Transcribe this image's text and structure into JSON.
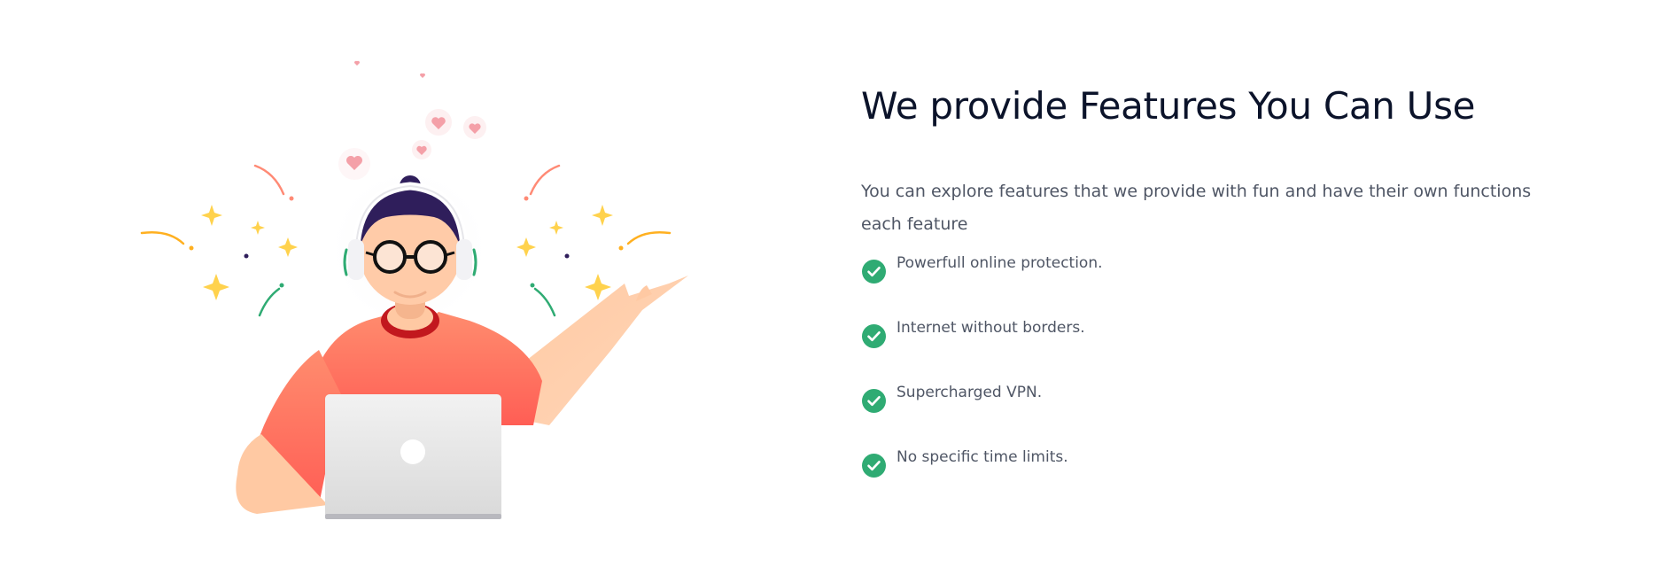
{
  "section": {
    "heading": "We provide Features You Can Use",
    "description": "You can explore features that we provide with fun and have their own functions each feature",
    "features": [
      {
        "label": "Powerfull online protection.",
        "icon": "check-circle-icon"
      },
      {
        "label": "Internet without borders.",
        "icon": "check-circle-icon"
      },
      {
        "label": "Supercharged VPN.",
        "icon": "check-circle-icon"
      },
      {
        "label": "No specific time limits.",
        "icon": "check-circle-icon"
      }
    ]
  },
  "illustration": {
    "subject": "person-with-headphones-and-laptop",
    "accent_check_color": "#2FAB73",
    "shirt_color": "#FF7260",
    "hair_color": "#2F1E5B",
    "skin_color": "#FFCBA8",
    "sparkle_color": "#FFD24D",
    "heart_color": "#F4A0A8"
  }
}
